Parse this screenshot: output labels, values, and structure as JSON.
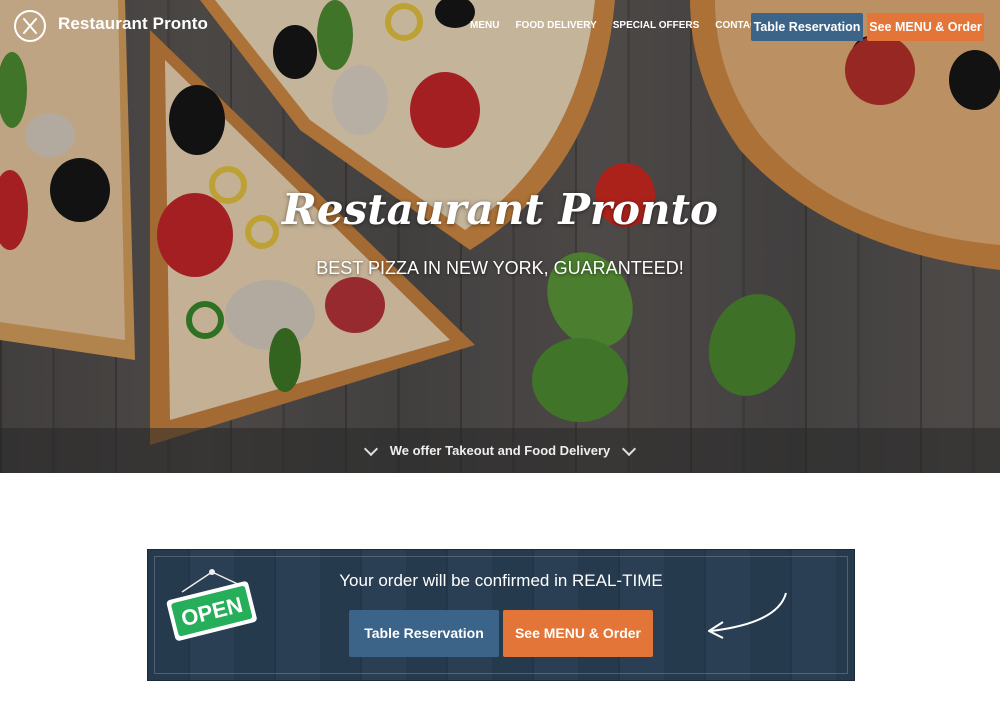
{
  "header": {
    "brand": "Restaurant Pronto",
    "nav": [
      "MENU",
      "FOOD DELIVERY",
      "SPECIAL OFFERS",
      "CONTACT US"
    ],
    "reservation_btn": "Table Reservation",
    "order_btn": "See MENU & Order"
  },
  "hero": {
    "title": "Restaurant Pronto",
    "subtitle": "BEST PIZZA IN NEW YORK, GUARANTEED!",
    "bottom_text": "We offer Takeout and Food Delivery"
  },
  "order_box": {
    "sign_text": "OPEN",
    "message": "Your order will be confirmed in REAL-TIME",
    "reservation_btn": "Table Reservation",
    "order_btn": "See MENU & Order"
  },
  "colors": {
    "primary_blue": "#3b6488",
    "accent_orange": "#e27537",
    "panel_navy": "#263a4e",
    "open_green": "#27ae5a"
  }
}
